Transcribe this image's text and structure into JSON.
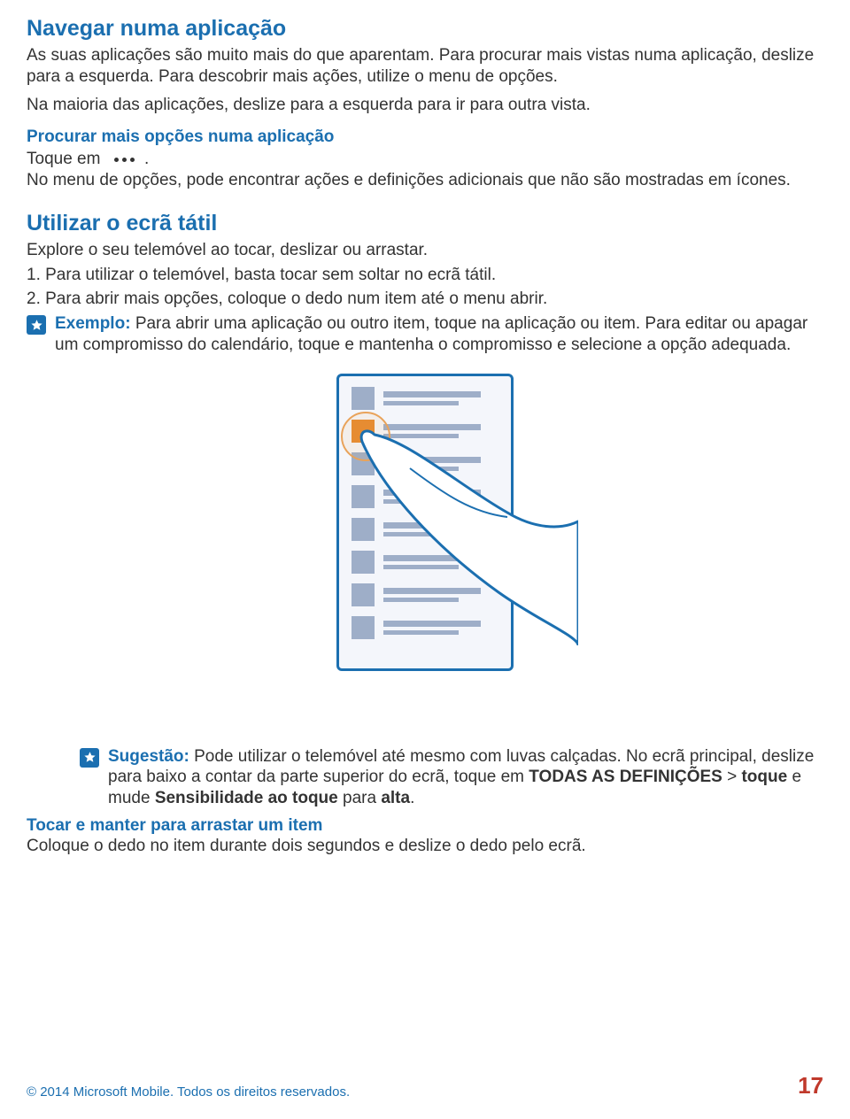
{
  "section1": {
    "heading": "Navegar numa aplicação",
    "intro": "As suas aplicações são muito mais do que aparentam. Para procurar mais vistas numa aplicação, deslize para a esquerda. Para descobrir mais ações, utilize o menu de opções.",
    "maj_line": "Na maioria das aplicações, deslize para a esquerda para ir para outra vista.",
    "sub1": "Procurar mais opções numa aplicação",
    "toque_prefix": "Toque em ",
    "toque_suffix": ".",
    "options_note": "No menu de opções, pode encontrar ações e definições adicionais que não são mostradas em ícones."
  },
  "section2": {
    "heading": "Utilizar o ecrã tátil",
    "intro": "Explore o seu telemóvel ao tocar, deslizar ou arrastar.",
    "step1": "1. Para utilizar o telemóvel, basta tocar sem soltar no ecrã tátil.",
    "step2": "2. Para abrir mais opções, coloque o dedo num item até o menu abrir.",
    "example_label": "Exemplo: ",
    "example_text": "Para abrir uma aplicação ou outro item, toque na aplicação ou item. Para editar ou apagar um compromisso do calendário, toque e mantenha o compromisso e selecione a opção adequada."
  },
  "tip": {
    "label": "Sugestão: ",
    "part1": "Pode utilizar o telemóvel até mesmo com luvas calçadas. No ecrã principal, deslize para baixo a contar da parte superior do ecrã, toque em ",
    "bold1": "TODAS AS DEFINIÇÕES",
    "gt": " > ",
    "bold2": "toque",
    "part2": " e mude ",
    "bold3": "Sensibilidade ao toque",
    "part3": " para ",
    "bold4": "alta",
    "dot": "."
  },
  "drag": {
    "heading": "Tocar e manter para arrastar um item",
    "body": "Coloque o dedo no item durante dois segundos e deslize o dedo pelo ecrã."
  },
  "footer": {
    "copyright": "© 2014 Microsoft Mobile. Todos os direitos reservados.",
    "page": "17"
  }
}
